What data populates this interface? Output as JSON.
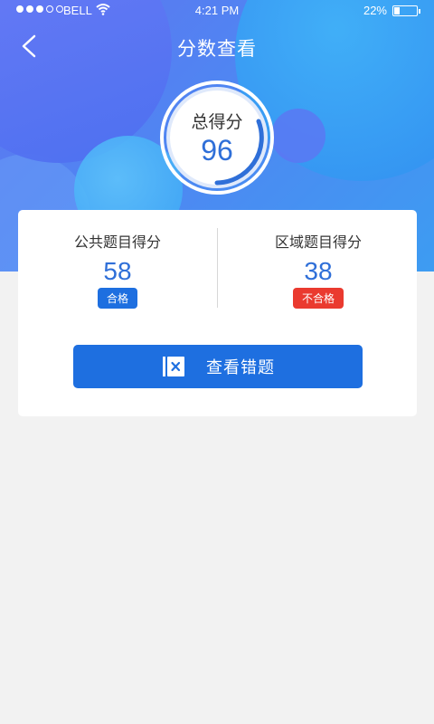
{
  "status_bar": {
    "carrier": "BELL",
    "time": "4:21 PM",
    "battery": "22%"
  },
  "header": {
    "title": "分数查看",
    "back_icon": "chevron-left-icon"
  },
  "total": {
    "label": "总得分",
    "value": "96"
  },
  "scores": {
    "public": {
      "label": "公共题目得分",
      "value": "58",
      "status": "合格"
    },
    "regional": {
      "label": "区域题目得分",
      "value": "38",
      "status": "不合格"
    }
  },
  "actions": {
    "view_wrong_label": "查看错题",
    "view_wrong_icon": "wrong-book-icon"
  },
  "colors": {
    "primary": "#1e6fe0",
    "pass": "#1e6fe0",
    "fail": "#ea3a2f",
    "score_text": "#2f6fd8"
  }
}
